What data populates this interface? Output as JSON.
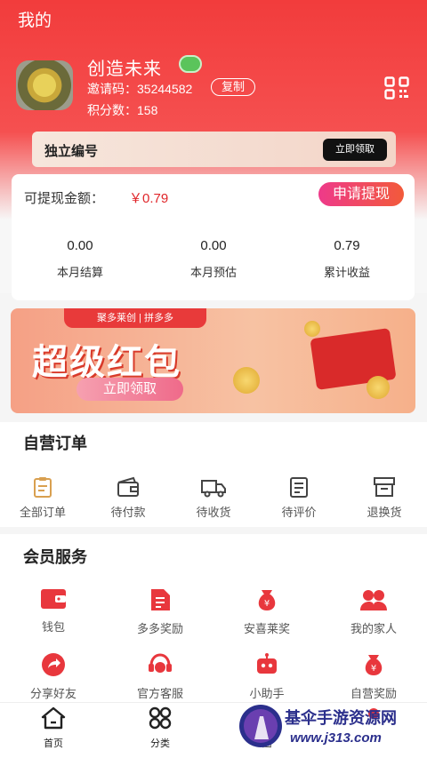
{
  "header": {
    "title": "我的",
    "username": "创造未来",
    "level_badge": "",
    "invite_label": "邀请码：",
    "invite_code": "35244582",
    "copy_label": "复制",
    "points_label": "积分数：",
    "points_value": "158"
  },
  "id_card": {
    "label": "独立编号",
    "button": "立即领取"
  },
  "wallet": {
    "withdrawable_label": "可提现金额：",
    "withdrawable_amount": "￥0.79",
    "withdraw_button": "申请提现",
    "stats": [
      {
        "value": "0.00",
        "label": "本月结算"
      },
      {
        "value": "0.00",
        "label": "本月预估"
      },
      {
        "value": "0.79",
        "label": "累计收益"
      }
    ]
  },
  "banner": {
    "logos": "聚多莱创 | 拼多多",
    "title": "超级红包",
    "button": "立即领取"
  },
  "orders": {
    "title": "自营订单",
    "items": [
      {
        "label": "全部订单",
        "icon": "clipboard-icon",
        "color": "#d9a050"
      },
      {
        "label": "待付款",
        "icon": "wallet-icon",
        "color": "#444"
      },
      {
        "label": "待收货",
        "icon": "truck-icon",
        "color": "#444"
      },
      {
        "label": "待评价",
        "icon": "document-icon",
        "color": "#444"
      },
      {
        "label": "退换货",
        "icon": "box-icon",
        "color": "#444"
      }
    ]
  },
  "services": {
    "title": "会员服务",
    "items": [
      {
        "label": "钱包",
        "icon": "wallet-icon"
      },
      {
        "label": "多多奖励",
        "icon": "reward-doc-icon"
      },
      {
        "label": "安喜莱奖",
        "icon": "money-bag-icon"
      },
      {
        "label": "我的家人",
        "icon": "family-icon"
      },
      {
        "label": "分享好友",
        "icon": "share-icon"
      },
      {
        "label": "官方客服",
        "icon": "headset-icon"
      },
      {
        "label": "小助手",
        "icon": "robot-icon"
      },
      {
        "label": "自营奖励",
        "icon": "money-bag-icon"
      }
    ],
    "accent": "#e8373d"
  },
  "tabbar": {
    "items": [
      {
        "label": "首页",
        "icon": "home-icon"
      },
      {
        "label": "分类",
        "icon": "category-icon"
      },
      {
        "label": "圈",
        "icon": "circle-icon"
      },
      {
        "label": "",
        "icon": "profile-icon"
      }
    ]
  },
  "watermark": {
    "text": "基伞手游资源网",
    "url": "www.j313.com"
  }
}
